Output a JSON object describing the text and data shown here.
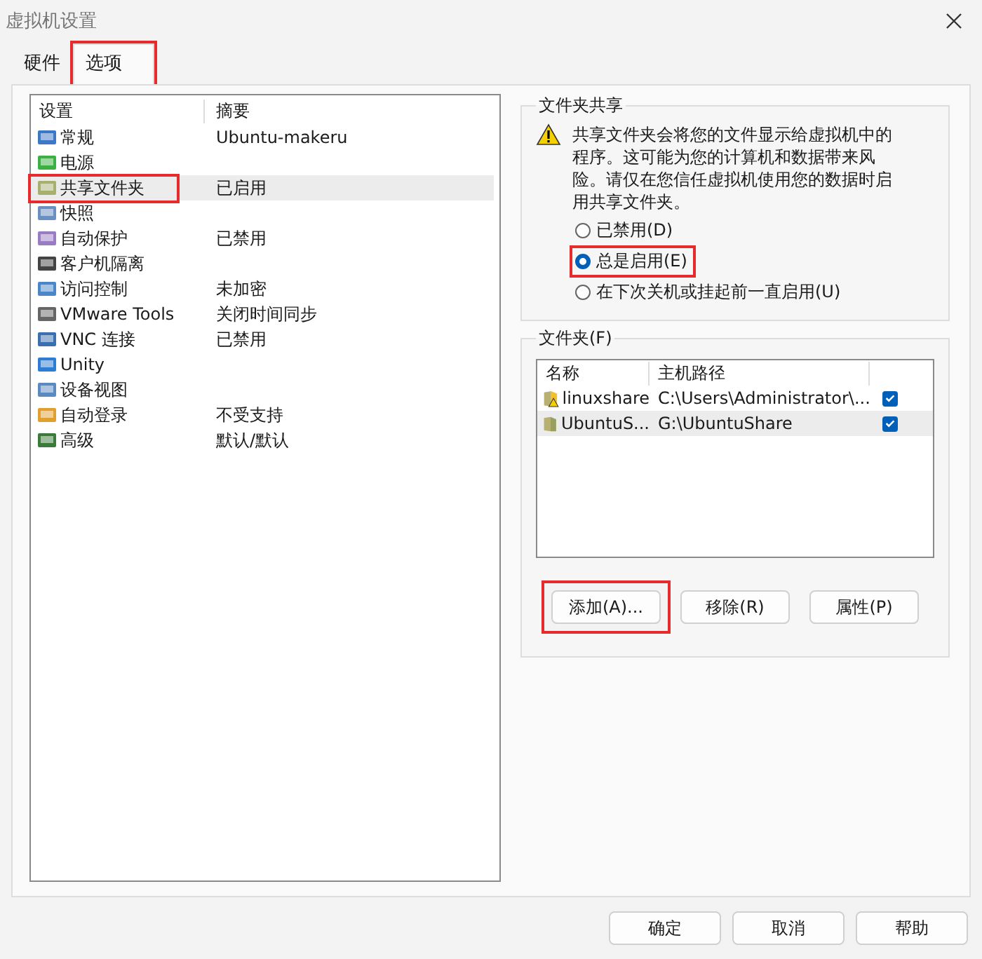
{
  "window": {
    "title": "虚拟机设置"
  },
  "tabs": [
    {
      "label": "硬件",
      "selected": false,
      "highlighted": false
    },
    {
      "label": "选项",
      "selected": true,
      "highlighted": true
    }
  ],
  "settings": {
    "columns": [
      "设置",
      "摘要"
    ],
    "rows": [
      {
        "name": "常规",
        "summary": "Ubuntu-makeru",
        "selected": false,
        "highlighted": false
      },
      {
        "name": "电源",
        "summary": "",
        "selected": false,
        "highlighted": false
      },
      {
        "name": "共享文件夹",
        "summary": "已启用",
        "selected": true,
        "highlighted": true
      },
      {
        "name": "快照",
        "summary": "",
        "selected": false,
        "highlighted": false
      },
      {
        "name": "自动保护",
        "summary": "已禁用",
        "selected": false,
        "highlighted": false
      },
      {
        "name": "客户机隔离",
        "summary": "",
        "selected": false,
        "highlighted": false
      },
      {
        "name": "访问控制",
        "summary": "未加密",
        "selected": false,
        "highlighted": false
      },
      {
        "name": "VMware Tools",
        "summary": "关闭时间同步",
        "selected": false,
        "highlighted": false
      },
      {
        "name": "VNC 连接",
        "summary": "已禁用",
        "selected": false,
        "highlighted": false
      },
      {
        "name": "Unity",
        "summary": "",
        "selected": false,
        "highlighted": false
      },
      {
        "name": "设备视图",
        "summary": "",
        "selected": false,
        "highlighted": false
      },
      {
        "name": "自动登录",
        "summary": "不受支持",
        "selected": false,
        "highlighted": false
      },
      {
        "name": "高级",
        "summary": "默认/默认",
        "selected": false,
        "highlighted": false
      }
    ]
  },
  "sharing": {
    "title": "文件夹共享",
    "warning": "共享文件夹会将您的文件显示给虚拟机中的程序。这可能为您的计算机和数据带来风险。请仅在您信任虚拟机使用您的数据时启用共享文件夹。",
    "options": [
      {
        "label": "已禁用(D)",
        "selected": false,
        "highlighted": false
      },
      {
        "label": "总是启用(E)",
        "selected": true,
        "highlighted": true
      },
      {
        "label": "在下次关机或挂起前一直启用(U)",
        "selected": false,
        "highlighted": false
      }
    ]
  },
  "folders": {
    "title": "文件夹(F)",
    "columns": [
      "名称",
      "主机路径"
    ],
    "rows": [
      {
        "name": "linuxshare",
        "path": "C:\\Users\\Administrator\\...",
        "enabled": true,
        "warning": true,
        "selected": false
      },
      {
        "name": "UbuntuS...",
        "path": "G:\\UbuntuShare",
        "enabled": true,
        "warning": false,
        "selected": true
      }
    ],
    "buttons": [
      {
        "label": "添加(A)...",
        "highlighted": true
      },
      {
        "label": "移除(R)",
        "highlighted": false
      },
      {
        "label": "属性(P)",
        "highlighted": false
      }
    ]
  },
  "buttons": [
    "确定",
    "取消",
    "帮助"
  ]
}
